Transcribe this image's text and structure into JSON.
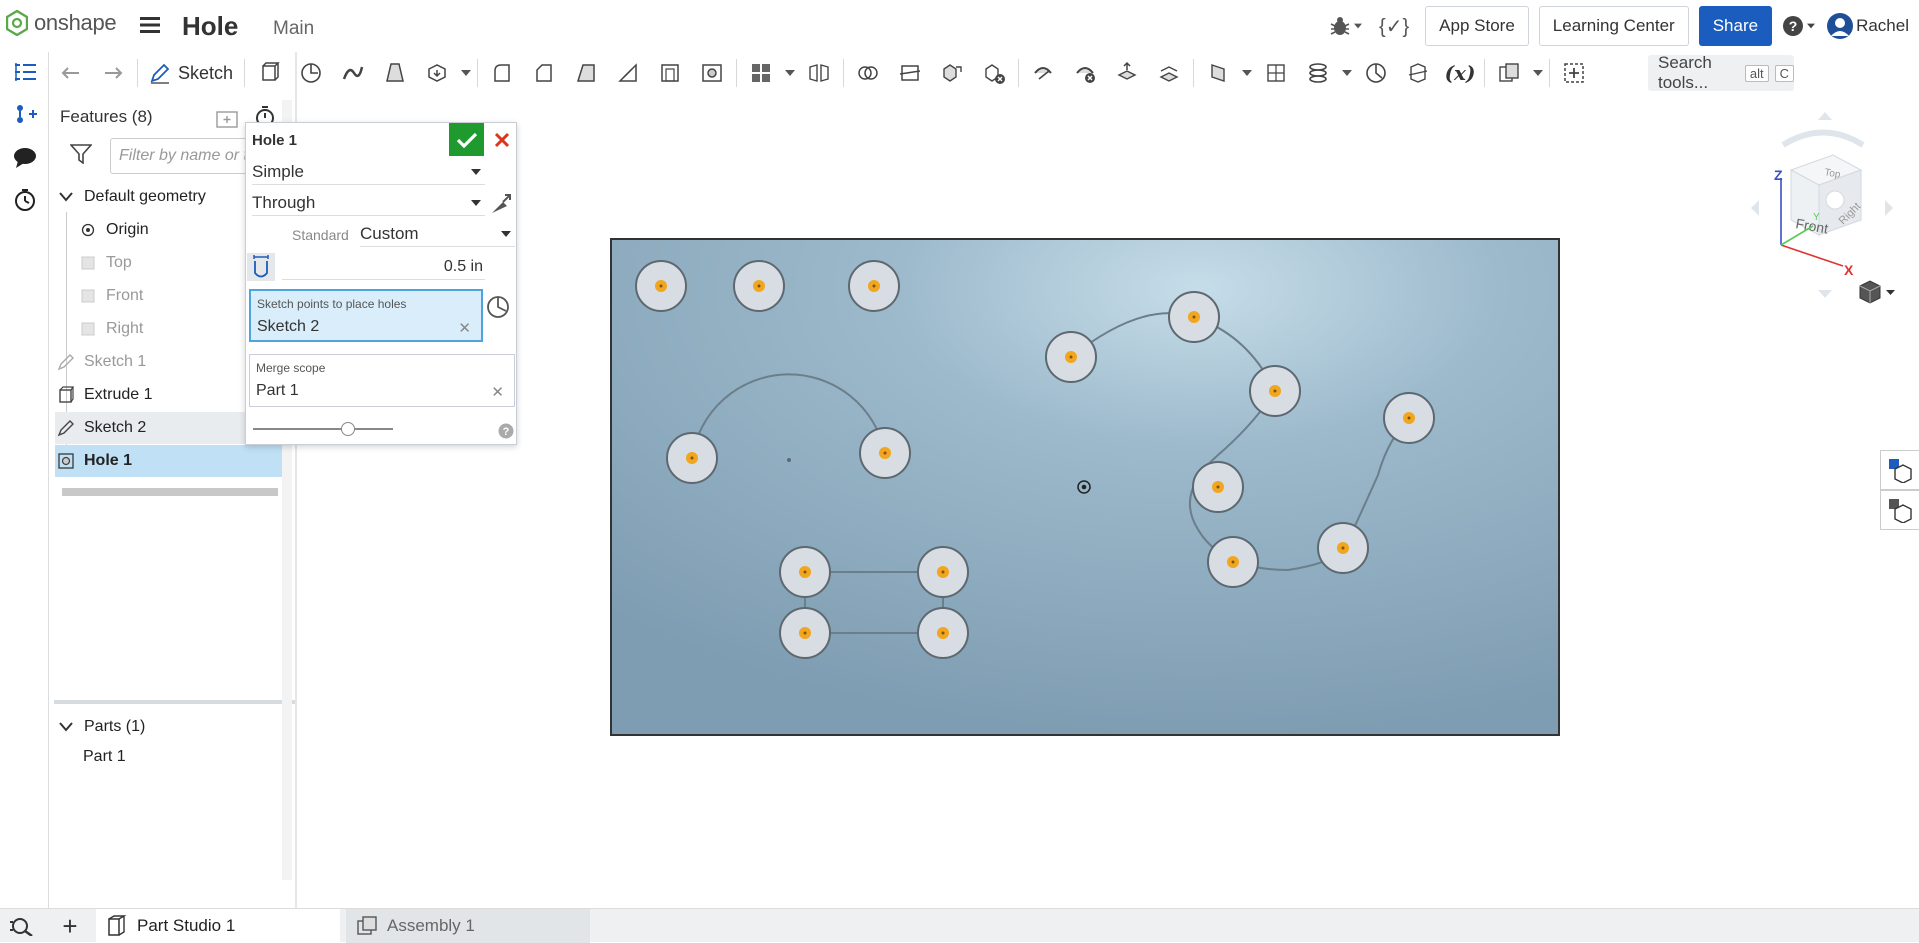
{
  "app": {
    "brand": "onshape",
    "doc_title": "Hole",
    "branch": "Main",
    "app_store": "App Store",
    "learning_center": "Learning Center",
    "share": "Share",
    "user": "Rachel"
  },
  "toolbar": {
    "sketch_label": "Sketch",
    "search_placeholder": "Search tools...",
    "search_shortcut_1": "alt",
    "search_shortcut_2": "C"
  },
  "features": {
    "header": "Features (8)",
    "filter_placeholder": "Filter by name or type",
    "default_geometry": "Default geometry",
    "items": [
      {
        "label": "Origin"
      },
      {
        "label": "Top"
      },
      {
        "label": "Front"
      },
      {
        "label": "Right"
      },
      {
        "label": "Sketch 1"
      },
      {
        "label": "Extrude 1"
      },
      {
        "label": "Sketch 2"
      },
      {
        "label": "Hole 1"
      }
    ],
    "parts_header": "Parts (1)",
    "parts": [
      {
        "label": "Part 1"
      }
    ]
  },
  "dialog": {
    "title": "Hole 1",
    "hole_style": "Simple",
    "termination": "Through",
    "standard_label": "Standard",
    "standard_value": "Custom",
    "diameter": "0.5 in",
    "sketch_points_label": "Sketch points to place holes",
    "sketch_points_value": "Sketch 2",
    "merge_label": "Merge scope",
    "merge_value": "Part 1",
    "slider_level": 0.7
  },
  "viewcube": {
    "top": "Top",
    "front": "Front",
    "right": "Right",
    "axis_x": "X",
    "axis_y": "Y",
    "axis_z": "Z"
  },
  "tabs": [
    {
      "label": "Part Studio 1",
      "active": true
    },
    {
      "label": "Assembly 1",
      "active": false
    }
  ],
  "colors": {
    "brand_blue": "#1b5dbe",
    "ok_green": "#1e9a2e",
    "cancel_red": "#d9381e",
    "hole_orange": "#f2a51e",
    "part_face": "#87a5bb",
    "selection_blue": "#bfe0f5"
  }
}
